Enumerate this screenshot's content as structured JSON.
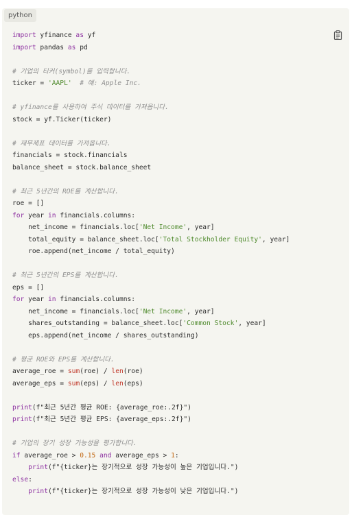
{
  "language_label": "python",
  "colors": {
    "background": "#f5f5f0",
    "keyword": "#8c2fa0",
    "string": "#4f8a2d",
    "comment": "#8f8f8f",
    "number": "#c1650f",
    "builtin": "#c0392b",
    "text": "#2b2b2b"
  },
  "icons": {
    "copy": "clipboard-icon"
  },
  "code_lines": [
    [
      [
        "kw",
        "import"
      ],
      [
        "p",
        " yfinance "
      ],
      [
        "kw",
        "as"
      ],
      [
        "p",
        " yf"
      ]
    ],
    [
      [
        "kw",
        "import"
      ],
      [
        "p",
        " pandas "
      ],
      [
        "kw",
        "as"
      ],
      [
        "p",
        " pd"
      ]
    ],
    [],
    [
      [
        "c",
        "# 기업의 티커(symbol)를 입력합니다."
      ]
    ],
    [
      [
        "p",
        "ticker = "
      ],
      [
        "s",
        "'AAPL'"
      ],
      [
        "p",
        "  "
      ],
      [
        "c",
        "# 예: Apple Inc."
      ]
    ],
    [],
    [
      [
        "c",
        "# yfinance를 사용하여 주식 데이터를 가져옵니다."
      ]
    ],
    [
      [
        "p",
        "stock = yf.Ticker(ticker)"
      ]
    ],
    [],
    [
      [
        "c",
        "# 재무제표 데이터를 가져옵니다."
      ]
    ],
    [
      [
        "p",
        "financials = stock.financials"
      ]
    ],
    [
      [
        "p",
        "balance_sheet = stock.balance_sheet"
      ]
    ],
    [],
    [
      [
        "c",
        "# 최근 5년간의 ROE를 계산합니다."
      ]
    ],
    [
      [
        "p",
        "roe = []"
      ]
    ],
    [
      [
        "kw",
        "for"
      ],
      [
        "p",
        " year "
      ],
      [
        "kw",
        "in"
      ],
      [
        "p",
        " financials.columns:"
      ]
    ],
    [
      [
        "p",
        "    net_income = financials.loc["
      ],
      [
        "s",
        "'Net Income'"
      ],
      [
        "p",
        ", year]"
      ]
    ],
    [
      [
        "p",
        "    total_equity = balance_sheet.loc["
      ],
      [
        "s",
        "'Total Stockholder Equity'"
      ],
      [
        "p",
        ", year]"
      ]
    ],
    [
      [
        "p",
        "    roe.append(net_income / total_equity)"
      ]
    ],
    [],
    [
      [
        "c",
        "# 최근 5년간의 EPS를 계산합니다."
      ]
    ],
    [
      [
        "p",
        "eps = []"
      ]
    ],
    [
      [
        "kw",
        "for"
      ],
      [
        "p",
        " year "
      ],
      [
        "kw",
        "in"
      ],
      [
        "p",
        " financials.columns:"
      ]
    ],
    [
      [
        "p",
        "    net_income = financials.loc["
      ],
      [
        "s",
        "'Net Income'"
      ],
      [
        "p",
        ", year]"
      ]
    ],
    [
      [
        "p",
        "    shares_outstanding = balance_sheet.loc["
      ],
      [
        "s",
        "'Common Stock'"
      ],
      [
        "p",
        ", year]"
      ]
    ],
    [
      [
        "p",
        "    eps.append(net_income / shares_outstanding)"
      ]
    ],
    [],
    [
      [
        "c",
        "# 평균 ROE와 EPS를 계산합니다."
      ]
    ],
    [
      [
        "p",
        "average_roe = "
      ],
      [
        "f",
        "sum"
      ],
      [
        "p",
        "(roe) / "
      ],
      [
        "f",
        "len"
      ],
      [
        "p",
        "(roe)"
      ]
    ],
    [
      [
        "p",
        "average_eps = "
      ],
      [
        "f",
        "sum"
      ],
      [
        "p",
        "(eps) / "
      ],
      [
        "f",
        "len"
      ],
      [
        "p",
        "(eps)"
      ]
    ],
    [],
    [
      [
        "kw",
        "print"
      ],
      [
        "p",
        "(f\"최근 5년간 평균 ROE: {average_roe:.2f}\")"
      ]
    ],
    [
      [
        "kw",
        "print"
      ],
      [
        "p",
        "(f\"최근 5년간 평균 EPS: {average_eps:.2f}\")"
      ]
    ],
    [],
    [
      [
        "c",
        "# 기업의 장기 성장 가능성을 평가합니다."
      ]
    ],
    [
      [
        "kw",
        "if"
      ],
      [
        "p",
        " average_roe > "
      ],
      [
        "n",
        "0.15"
      ],
      [
        "p",
        " "
      ],
      [
        "kw",
        "and"
      ],
      [
        "p",
        " average_eps > "
      ],
      [
        "n",
        "1"
      ],
      [
        "p",
        ":"
      ]
    ],
    [
      [
        "p",
        "    "
      ],
      [
        "kw",
        "print"
      ],
      [
        "p",
        "(f\"{ticker}는 장기적으로 성장 가능성이 높은 기업입니다.\")"
      ]
    ],
    [
      [
        "kw",
        "else"
      ],
      [
        "p",
        ":"
      ]
    ],
    [
      [
        "p",
        "    "
      ],
      [
        "kw",
        "print"
      ],
      [
        "p",
        "(f\"{ticker}는 장기적으로 성장 가능성이 낮은 기업입니다.\")"
      ]
    ]
  ]
}
